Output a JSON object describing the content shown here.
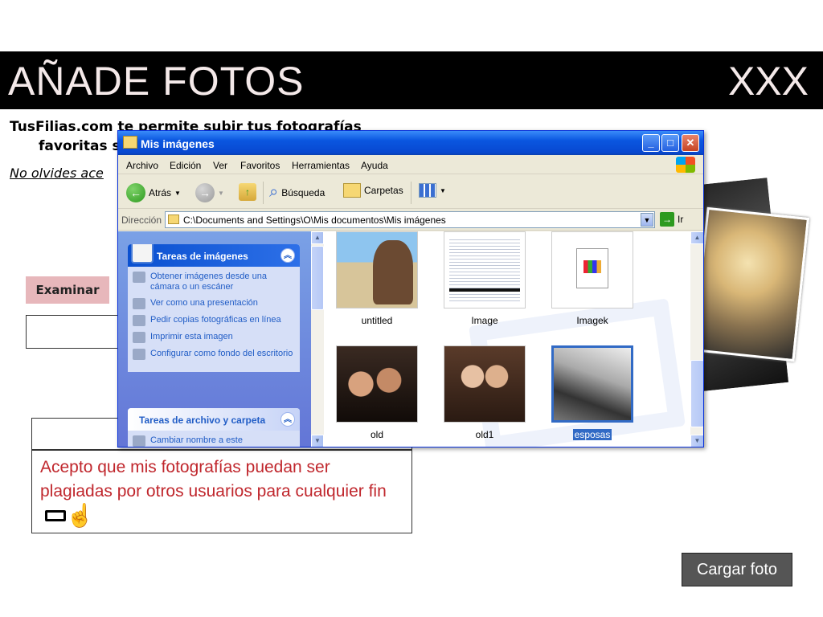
{
  "header": {
    "title": "AÑADE FOTOS",
    "right_text": "XXX"
  },
  "intro": {
    "line1": "TusFilias.com te permite subir tus fotografías",
    "line2": "favoritas s"
  },
  "reminder": "No olvides ace",
  "buttons": {
    "examinar": "Examinar",
    "cargar": "Cargar foto"
  },
  "consent": {
    "text": "Acepto que mis fotografías puedan ser plagiadas por otros usuarios para cualquier fin"
  },
  "explorer": {
    "title": "Mis imágenes",
    "menu": [
      "Archivo",
      "Edición",
      "Ver",
      "Favoritos",
      "Herramientas",
      "Ayuda"
    ],
    "toolbar": {
      "back": "Atrás",
      "search": "Búsqueda",
      "folders": "Carpetas"
    },
    "address": {
      "label": "Dirección",
      "path": "C:\\Documents and Settings\\O\\Mis documentos\\Mis imágenes",
      "go": "Ir"
    },
    "tasks_title": "Tareas de imágenes",
    "tasks": [
      "Obtener imágenes desde una cámara o un escáner",
      "Ver como una presentación",
      "Pedir copias fotográficas en línea",
      "Imprimir esta imagen",
      "Configurar como fondo del escritorio"
    ],
    "file_tasks_title": "Tareas de archivo y carpeta",
    "file_tasks": [
      "Cambiar nombre a este"
    ],
    "files": [
      {
        "name": "untitled"
      },
      {
        "name": "Image"
      },
      {
        "name": "Imagek"
      },
      {
        "name": "old"
      },
      {
        "name": "old1"
      },
      {
        "name": "esposas",
        "selected": true
      }
    ]
  }
}
